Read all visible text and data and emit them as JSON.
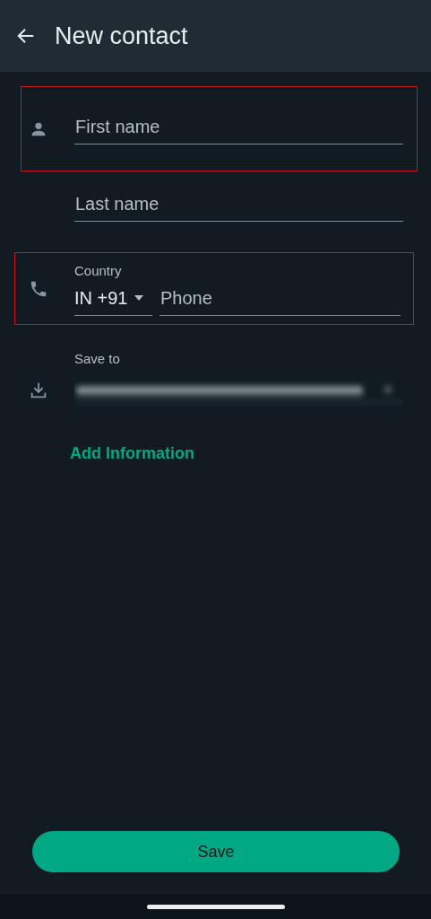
{
  "header": {
    "title": "New contact"
  },
  "name_fields": [
    {
      "placeholder": "First name",
      "highlighted": true
    },
    {
      "placeholder": "Last name",
      "highlighted": false
    }
  ],
  "phone": {
    "country_label": "Country",
    "country_code": "IN +91",
    "placeholder": "Phone",
    "highlighted": true
  },
  "save_to": {
    "label": "Save to",
    "account_blurred": true
  },
  "add_information": "Add Information",
  "save_button": "Save"
}
